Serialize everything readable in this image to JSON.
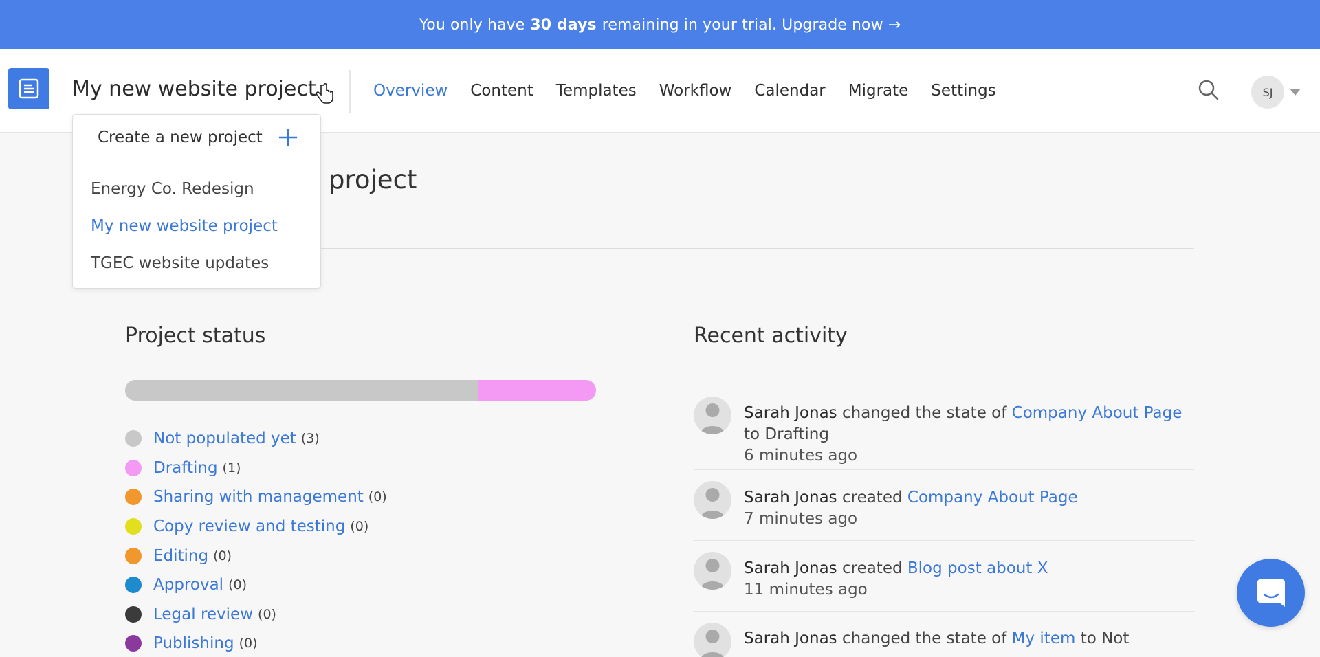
{
  "banner": {
    "text_before": "You only have",
    "bold": "30 days",
    "text_after": "remaining in your trial. Upgrade now →"
  },
  "header": {
    "logo_icon": "document-logo-icon",
    "project_title": "My new website project",
    "tabs": [
      {
        "label": "Overview",
        "active": true
      },
      {
        "label": "Content",
        "active": false
      },
      {
        "label": "Templates",
        "active": false
      },
      {
        "label": "Workflow",
        "active": false
      },
      {
        "label": "Calendar",
        "active": false
      },
      {
        "label": "Migrate",
        "active": false
      },
      {
        "label": "Settings",
        "active": false
      }
    ],
    "search_icon": "search-icon",
    "avatar_initials": "SJ"
  },
  "dropdown": {
    "create_label": "Create a new project",
    "create_icon": "plus-icon",
    "projects": [
      {
        "label": "Energy Co. Redesign",
        "selected": false
      },
      {
        "label": "My new website project",
        "selected": true
      },
      {
        "label": "TGEC website updates",
        "selected": false
      }
    ]
  },
  "page": {
    "heading_visible": "project"
  },
  "status": {
    "title": "Project status",
    "progress": [
      {
        "label": "Not populated yet",
        "fraction": 0.75,
        "color": "#c8c8c8"
      },
      {
        "label": "Drafting",
        "fraction": 0.25,
        "color": "#f49af4"
      }
    ],
    "items": [
      {
        "label": "Not populated yet",
        "count": "(3)",
        "color": "#c8c8c8"
      },
      {
        "label": "Drafting",
        "count": "(1)",
        "color": "#f49af4"
      },
      {
        "label": "Sharing with management",
        "count": "(0)",
        "color": "#f0982e"
      },
      {
        "label": "Copy review and testing",
        "count": "(0)",
        "color": "#e2df1f"
      },
      {
        "label": "Editing",
        "count": "(0)",
        "color": "#f0982e"
      },
      {
        "label": "Approval",
        "count": "(0)",
        "color": "#1f8bcf"
      },
      {
        "label": "Legal review",
        "count": "(0)",
        "color": "#3b3b3b"
      },
      {
        "label": "Publishing",
        "count": "(0)",
        "color": "#8a3a9d"
      }
    ]
  },
  "activity": {
    "title": "Recent activity",
    "items": [
      {
        "actor": "Sarah Jonas",
        "action": "changed the state of",
        "link": "Company About Page",
        "suffix": "to Drafting",
        "time": "6 minutes ago"
      },
      {
        "actor": "Sarah Jonas",
        "action": "created",
        "link": "Company About Page",
        "suffix": "",
        "time": "7 minutes ago"
      },
      {
        "actor": "Sarah Jonas",
        "action": "created",
        "link": "Blog post about X",
        "suffix": "",
        "time": "11 minutes ago"
      },
      {
        "actor": "Sarah Jonas",
        "action": "changed the state of",
        "link": "My item",
        "suffix": "to Not",
        "time": ""
      }
    ]
  },
  "chat_icon": "chat-icon",
  "colors": {
    "brand": "#3f7be3",
    "banner": "#4a80e8",
    "link": "#3b78d8"
  }
}
